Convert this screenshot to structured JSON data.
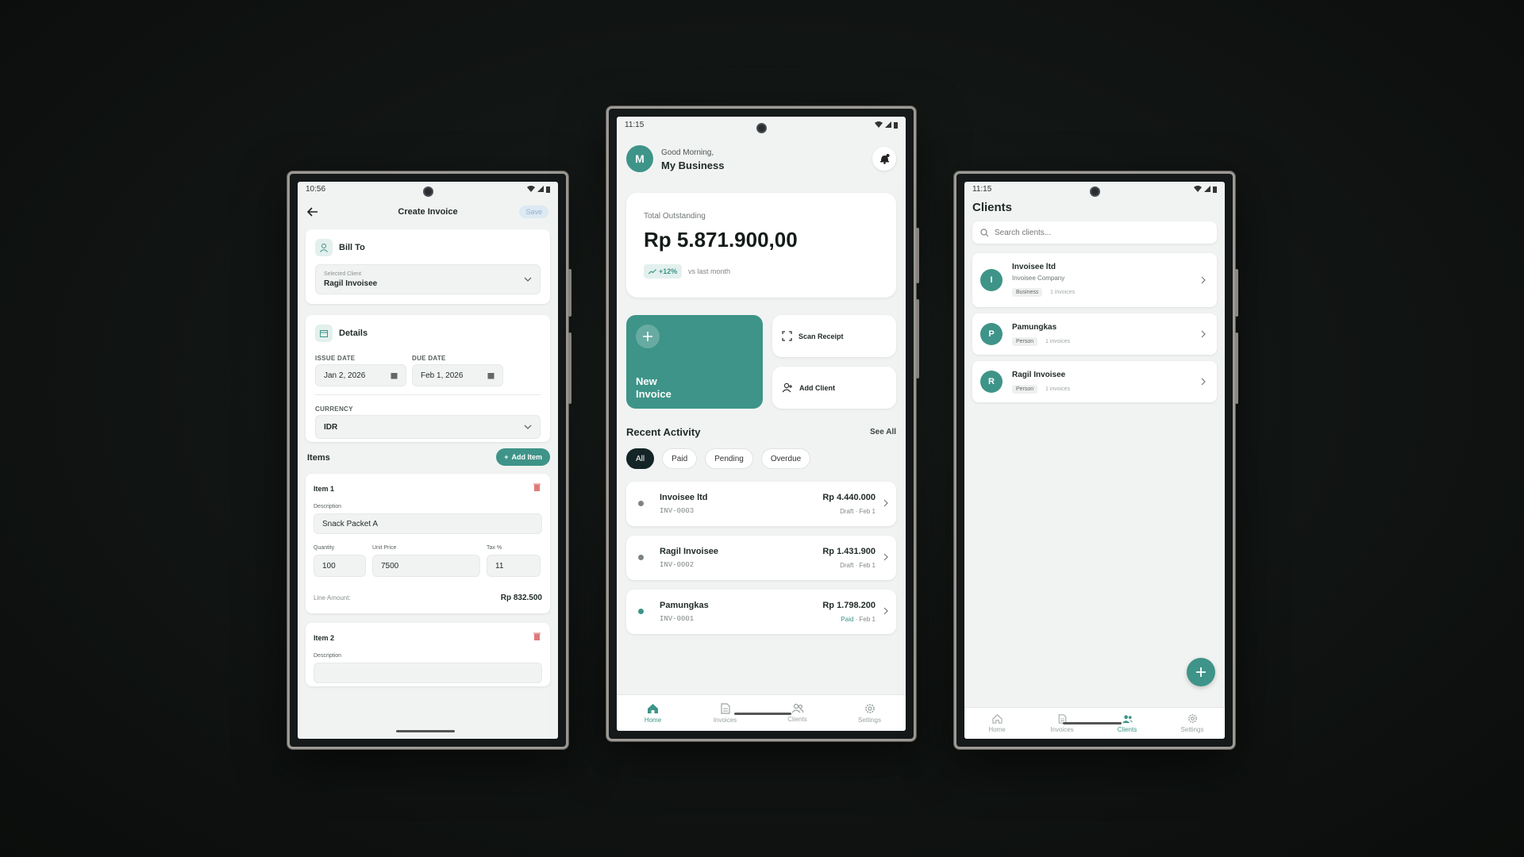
{
  "colors": {
    "accent": "#3e9488",
    "dark": "#142527",
    "danger": "#e07a7a"
  },
  "create_invoice": {
    "status_time": "10:56",
    "title": "Create Invoice",
    "save_label": "Save",
    "bill_to": {
      "title": "Bill To",
      "selected_label": "Selected Client",
      "selected_value": "Ragil Invoisee"
    },
    "details": {
      "title": "Details",
      "issue_label": "ISSUE DATE",
      "issue_value": "Jan 2, 2026",
      "due_label": "DUE DATE",
      "due_value": "Feb 1, 2026",
      "currency_label": "CURRENCY",
      "currency_value": "IDR"
    },
    "items_title": "Items",
    "add_item_label": "Add Item",
    "item1": {
      "title": "Item 1",
      "desc_label": "Description",
      "desc_value": "Snack Packet A",
      "qty_label": "Quantity",
      "qty_value": "100",
      "price_label": "Unit Price",
      "price_value": "7500",
      "tax_label": "Tax %",
      "tax_value": "11",
      "line_label": "Line Amount:",
      "line_value": "Rp 832.500"
    },
    "item2": {
      "title": "Item 2",
      "desc_label": "Description"
    }
  },
  "home": {
    "status_time": "11:15",
    "avatar_letter": "M",
    "greeting": "Good Morning,",
    "business": "My Business",
    "outstanding_label": "Total Outstanding",
    "outstanding_value": "Rp 5.871.900,00",
    "trend": "+12%",
    "trend_note": "vs last month",
    "new_invoice_line1": "New",
    "new_invoice_line2": "Invoice",
    "scan_receipt": "Scan Receipt",
    "add_client": "Add Client",
    "recent_title": "Recent Activity",
    "see_all": "See All",
    "filters": [
      "All",
      "Paid",
      "Pending",
      "Overdue"
    ],
    "activity": [
      {
        "name": "Invoisee ltd",
        "code": "INV-0003",
        "amount": "Rp 4.440.000",
        "status": "Draft",
        "date": "· Feb 1"
      },
      {
        "name": "Ragil Invoisee",
        "code": "INV-0002",
        "amount": "Rp 1.431.900",
        "status": "Draft",
        "date": "· Feb 1"
      },
      {
        "name": "Pamungkas",
        "code": "INV-0001",
        "amount": "Rp 1.798.200",
        "status": "Paid",
        "date": "· Feb 1"
      }
    ],
    "nav": [
      "Home",
      "Invoices",
      "Clients",
      "Settings"
    ]
  },
  "clients": {
    "status_time": "11:15",
    "title": "Clients",
    "search_placeholder": "Search clients...",
    "list": [
      {
        "letter": "I",
        "name": "Invoisee ltd",
        "company": "Invoisee Company",
        "tag": "Business",
        "count": "1 invoices"
      },
      {
        "letter": "P",
        "name": "Pamungkas",
        "company": "",
        "tag": "Person",
        "count": "1 invoices"
      },
      {
        "letter": "R",
        "name": "Ragil Invoisee",
        "company": "",
        "tag": "Person",
        "count": "1 invoices"
      }
    ],
    "nav": [
      "Home",
      "Invoices",
      "Clients",
      "Settings"
    ]
  }
}
